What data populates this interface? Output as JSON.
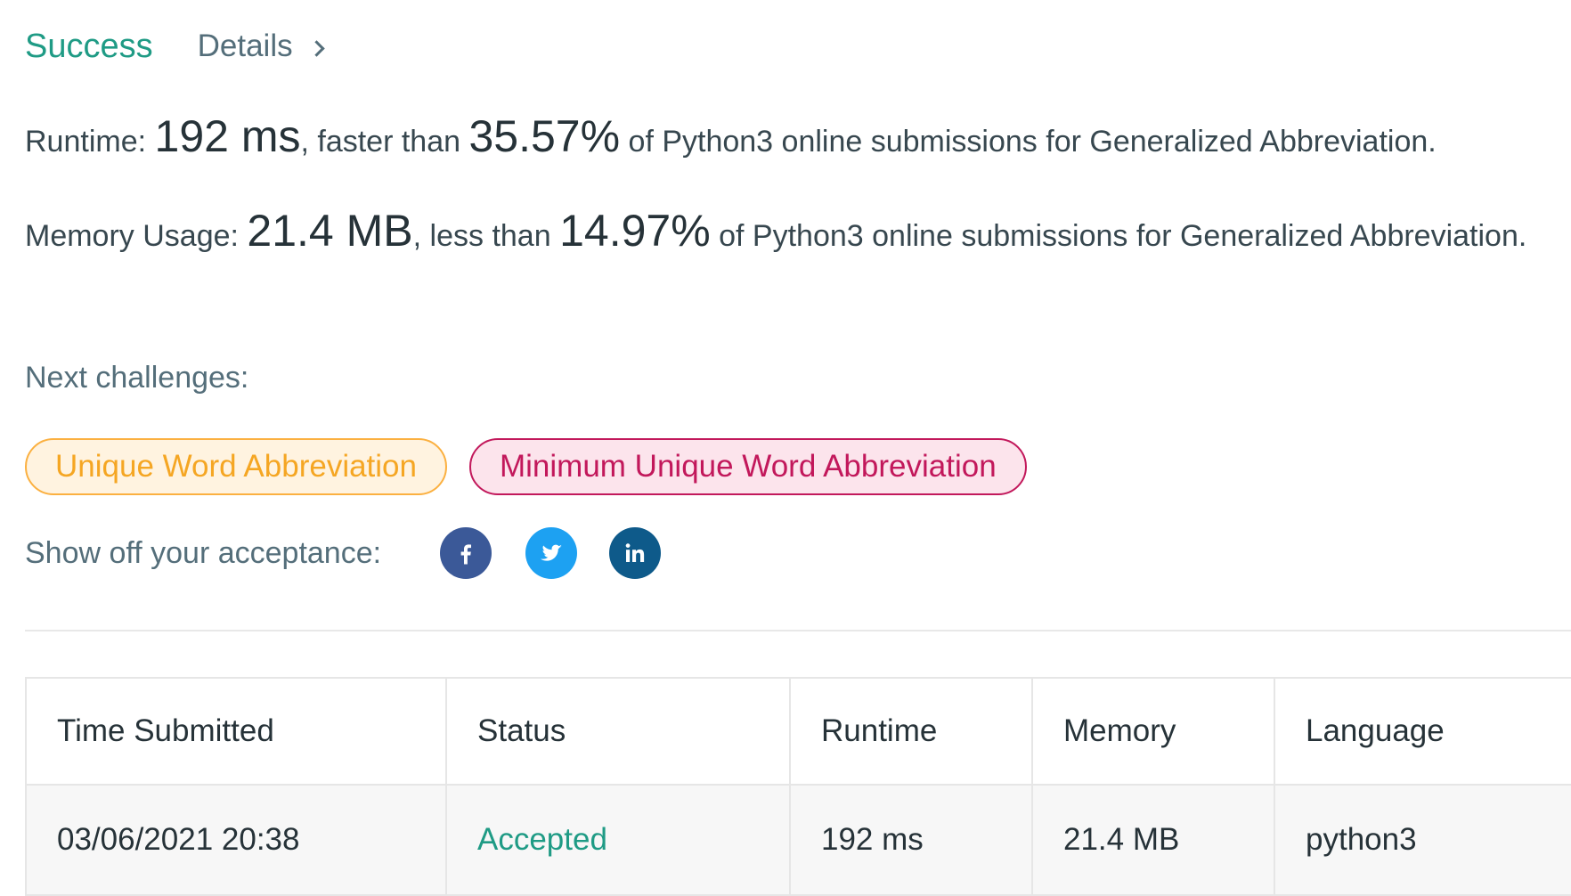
{
  "header": {
    "status": "Success",
    "details_link": "Details"
  },
  "runtime": {
    "label": "Runtime:",
    "value": "192 ms",
    "comparison": ", faster than",
    "percent": "35.57%",
    "suffix": "of Python3 online submissions for Generalized Abbreviation."
  },
  "memory": {
    "label": "Memory Usage:",
    "value": "21.4 MB",
    "comparison": ", less than",
    "percent": "14.97%",
    "suffix": "of Python3 online submissions for Generalized Abbreviation."
  },
  "next_challenges": {
    "label": "Next challenges:",
    "items": [
      {
        "label": "Unique Word Abbreviation",
        "difficulty": "medium"
      },
      {
        "label": "Minimum Unique Word Abbreviation",
        "difficulty": "hard"
      }
    ]
  },
  "share": {
    "label": "Show off your acceptance:",
    "icons": [
      "facebook-icon",
      "twitter-icon",
      "linkedin-icon"
    ]
  },
  "submissions": {
    "headers": [
      "Time Submitted",
      "Status",
      "Runtime",
      "Memory",
      "Language"
    ],
    "rows": [
      [
        "03/06/2021 20:38",
        "Accepted",
        "192 ms",
        "21.4 MB",
        "python3"
      ]
    ]
  },
  "colors": {
    "success": "#1f9b85",
    "medium": "#f5a623",
    "hard": "#c2185b",
    "facebook": "#3b5998",
    "twitter": "#1da1f2",
    "linkedin": "#0e5a8a"
  }
}
